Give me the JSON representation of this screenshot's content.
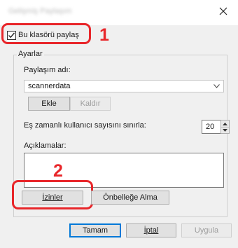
{
  "window": {
    "title": "Gelişmiş Paylaşım"
  },
  "share": {
    "checked": true,
    "label": "Bu klasörü paylaş"
  },
  "markers": {
    "one": "1",
    "two": "2"
  },
  "settings": {
    "group_title": "Ayarlar",
    "share_name_label": "Paylaşım adı:",
    "share_name_value": "scannerdata",
    "add_button": "Ekle",
    "remove_button": "Kaldır",
    "limit_label": "Eş zamanlı kullanıcı sayısını sınırla:",
    "limit_value": "20",
    "comments_label": "Açıklamalar:",
    "comments_value": "",
    "permissions_button": "İzinler",
    "caching_button": "Önbelleğe Alma"
  },
  "footer": {
    "ok_button": "Tamam",
    "cancel_button": "İptal",
    "apply_button": "Uygula"
  },
  "colors": {
    "highlight": "#e8262a",
    "focus": "#0078d7",
    "dialog_bg": "#f0f0f0"
  }
}
